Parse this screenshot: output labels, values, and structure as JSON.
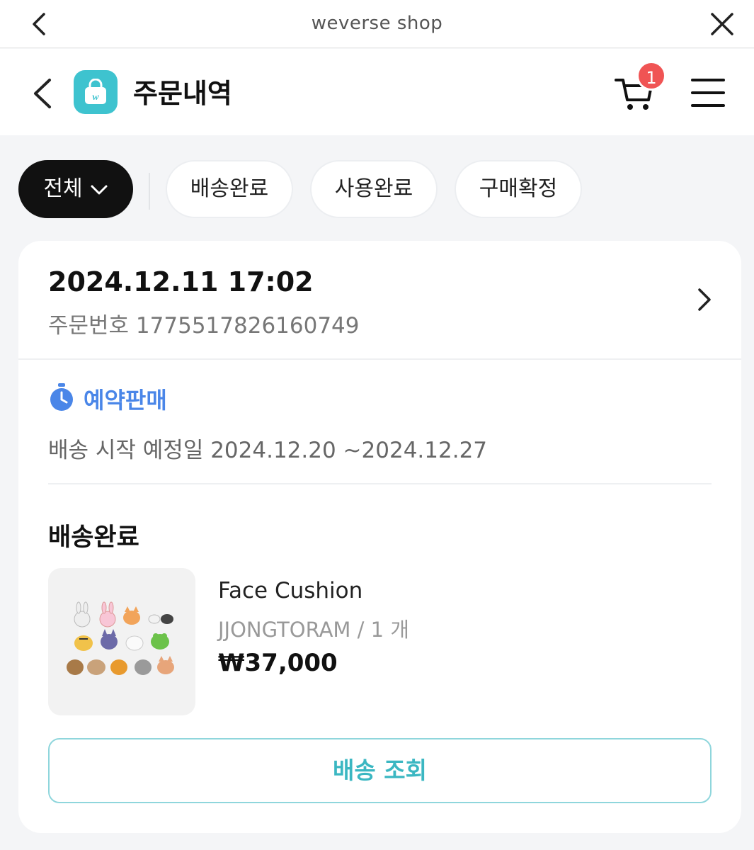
{
  "browser_bar": {
    "title": "weverse shop"
  },
  "header": {
    "title": "주문내역",
    "cart_count": "1"
  },
  "filters": [
    {
      "label": "전체",
      "active": true
    },
    {
      "label": "배송완료",
      "active": false
    },
    {
      "label": "사용완료",
      "active": false
    },
    {
      "label": "구매확정",
      "active": false
    }
  ],
  "order": {
    "date": "2024.12.11 17:02",
    "number": "주문번호 1775517826160749",
    "presale_label": "예약판매",
    "ship_schedule": "배송 시작 예정일 2024.12.20 ~2024.12.27",
    "status": "배송완료",
    "product": {
      "name": "Face Cushion",
      "option": "JJONGTORAM / 1 개",
      "price": "₩37,000"
    },
    "track_button": "배송 조회"
  },
  "colors": {
    "accent_teal": "#3ec3cf",
    "presale_blue": "#4a86e8",
    "badge_red": "#f05454"
  }
}
